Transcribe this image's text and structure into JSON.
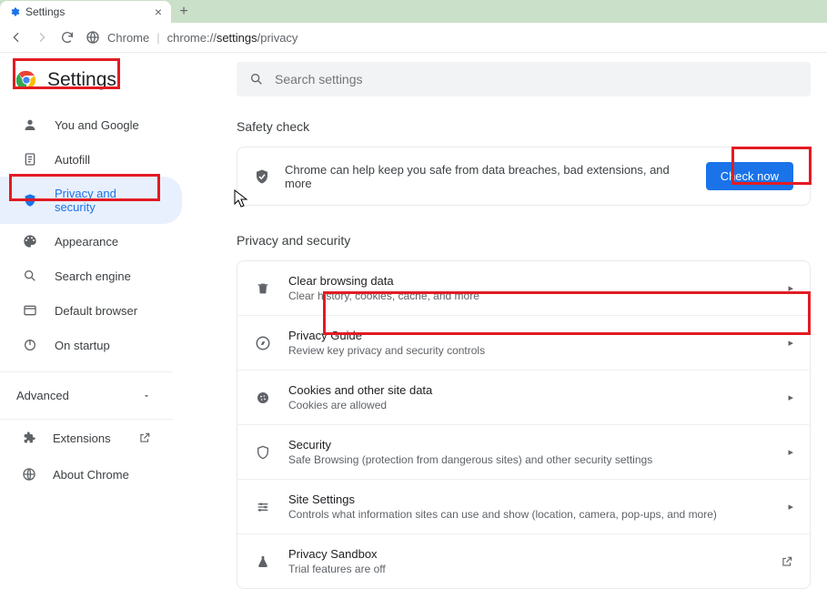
{
  "browser": {
    "tab_title": "Settings",
    "url_scheme": "Chrome",
    "url_path_prefix": "chrome://",
    "url_path_bold": "settings",
    "url_path_suffix": "/privacy"
  },
  "app": {
    "title": "Settings"
  },
  "sidebar": {
    "items": [
      {
        "label": "You and Google",
        "icon": "person-icon"
      },
      {
        "label": "Autofill",
        "icon": "autofill-icon"
      },
      {
        "label": "Privacy and security",
        "icon": "shield-icon",
        "active": true
      },
      {
        "label": "Appearance",
        "icon": "palette-icon"
      },
      {
        "label": "Search engine",
        "icon": "search-icon"
      },
      {
        "label": "Default browser",
        "icon": "browser-icon"
      },
      {
        "label": "On startup",
        "icon": "power-icon"
      }
    ],
    "advanced_label": "Advanced",
    "footer": [
      {
        "label": "Extensions",
        "icon": "extension-icon",
        "external": true
      },
      {
        "label": "About Chrome",
        "icon": "globe-icon"
      }
    ]
  },
  "search": {
    "placeholder": "Search settings"
  },
  "safety": {
    "section_title": "Safety check",
    "text": "Chrome can help keep you safe from data breaches, bad extensions, and more",
    "button": "Check now"
  },
  "privacy": {
    "section_title": "Privacy and security",
    "rows": [
      {
        "title": "Clear browsing data",
        "sub": "Clear history, cookies, cache, and more",
        "icon": "trash-icon"
      },
      {
        "title": "Privacy Guide",
        "sub": "Review key privacy and security controls",
        "icon": "compass-icon"
      },
      {
        "title": "Cookies and other site data",
        "sub": "Cookies are allowed",
        "icon": "cookie-icon"
      },
      {
        "title": "Security",
        "sub": "Safe Browsing (protection from dangerous sites) and other security settings",
        "icon": "security-icon"
      },
      {
        "title": "Site Settings",
        "sub": "Controls what information sites can use and show (location, camera, pop-ups, and more)",
        "icon": "sliders-icon"
      },
      {
        "title": "Privacy Sandbox",
        "sub": "Trial features are off",
        "icon": "flask-icon",
        "external": true
      }
    ]
  }
}
